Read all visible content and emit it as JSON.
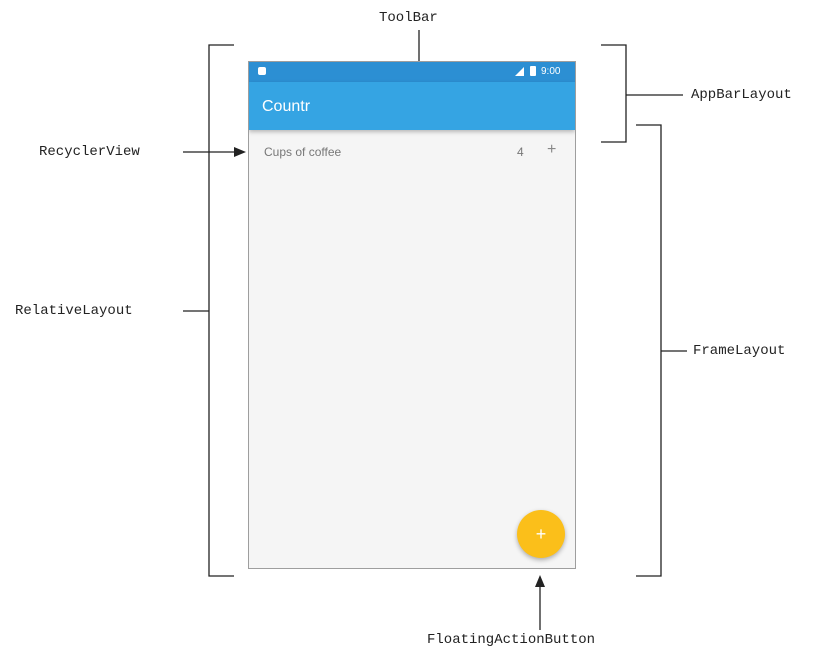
{
  "labels": {
    "toolbar": "ToolBar",
    "app_bar_layout": "AppBarLayout",
    "recycler_view": "RecyclerView",
    "relative_layout": "RelativeLayout",
    "frame_layout": "FrameLayout",
    "floating_action_button": "FloatingActionButton"
  },
  "phone": {
    "status_bar": {
      "time": "9:00"
    },
    "toolbar": {
      "title": "Countr"
    },
    "list": [
      {
        "label": "Cups of coffee",
        "count": "4",
        "action": "+"
      }
    ],
    "fab": {
      "icon": "+"
    }
  },
  "colors": {
    "status_bar": "#2c8fd3",
    "toolbar": "#35a4e3",
    "fab": "#fbbf1a",
    "screen_background": "#f5f5f5"
  },
  "icons": [
    "app-notification-icon",
    "signal-icon",
    "battery-icon",
    "add-icon",
    "fab-add-icon"
  ]
}
